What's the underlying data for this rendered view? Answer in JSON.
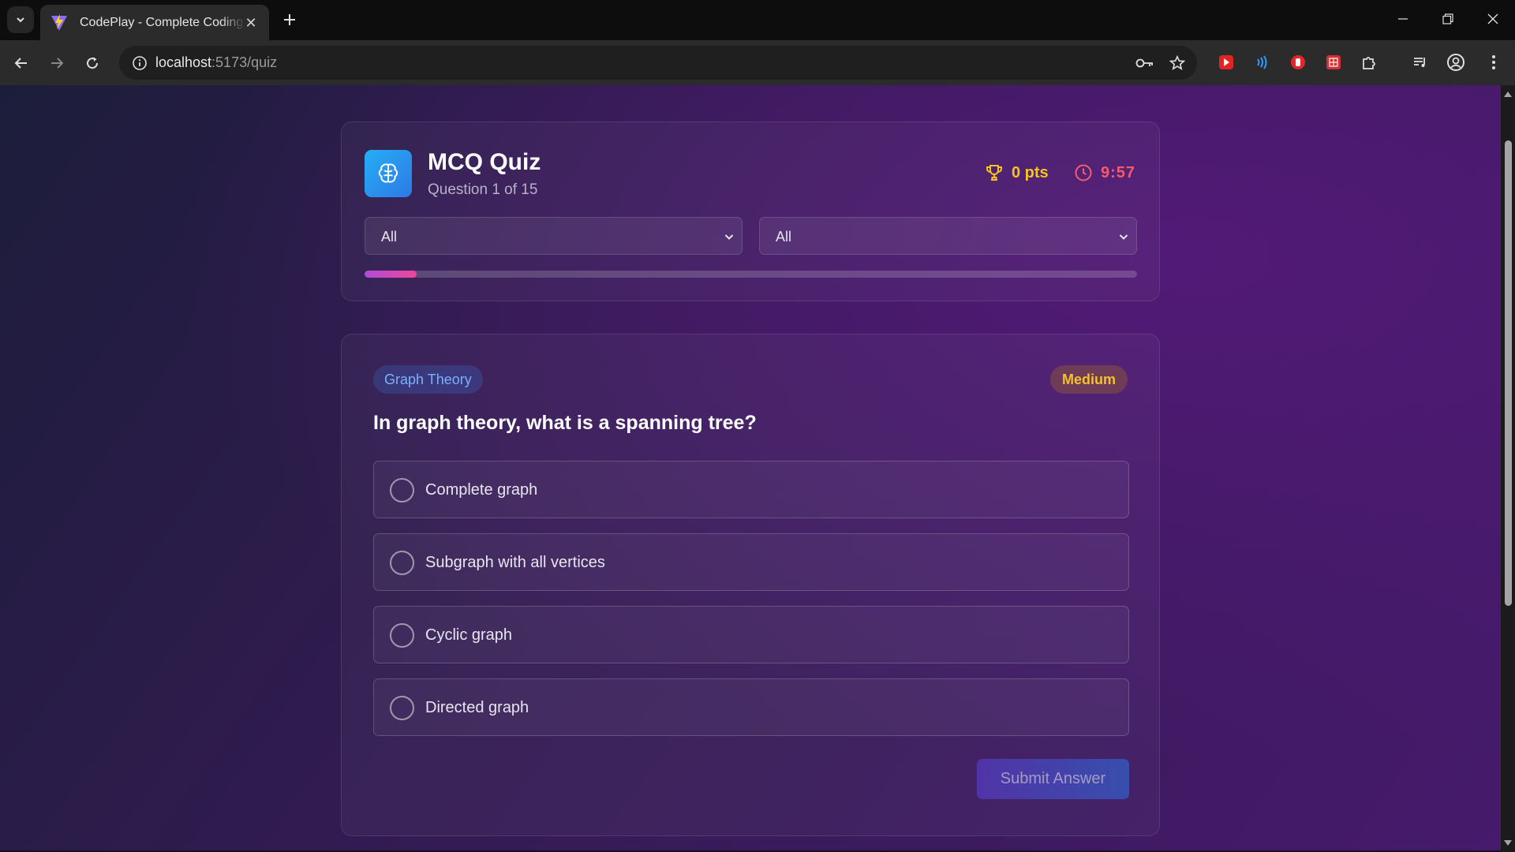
{
  "browser": {
    "tab_title": "CodePlay - Complete Coding Guide",
    "url_host": "localhost",
    "url_path": ":5173/quiz"
  },
  "header": {
    "title": "MCQ Quiz",
    "subtitle": "Question 1 of 15",
    "score": "0 pts",
    "timer": "9:57",
    "progress_fraction": 0.067,
    "filters": [
      {
        "value": "All"
      },
      {
        "value": "All"
      }
    ]
  },
  "question": {
    "topic": "Graph Theory",
    "difficulty": "Medium",
    "text": "In graph theory, what is a spanning tree?",
    "options": [
      {
        "label": "Complete graph"
      },
      {
        "label": "Subgraph with all vertices"
      },
      {
        "label": "Cyclic graph"
      },
      {
        "label": "Directed graph"
      }
    ],
    "submit_label": "Submit Answer"
  },
  "colors": {
    "accent_gold": "#f5c518",
    "accent_red": "#f45b6e",
    "topic_blue": "#7db0fb",
    "progress_start": "#b04ad9",
    "progress_end": "#ec4899"
  },
  "icons": {
    "badge": "brain-icon",
    "score": "trophy-icon",
    "timer": "clock-icon"
  }
}
